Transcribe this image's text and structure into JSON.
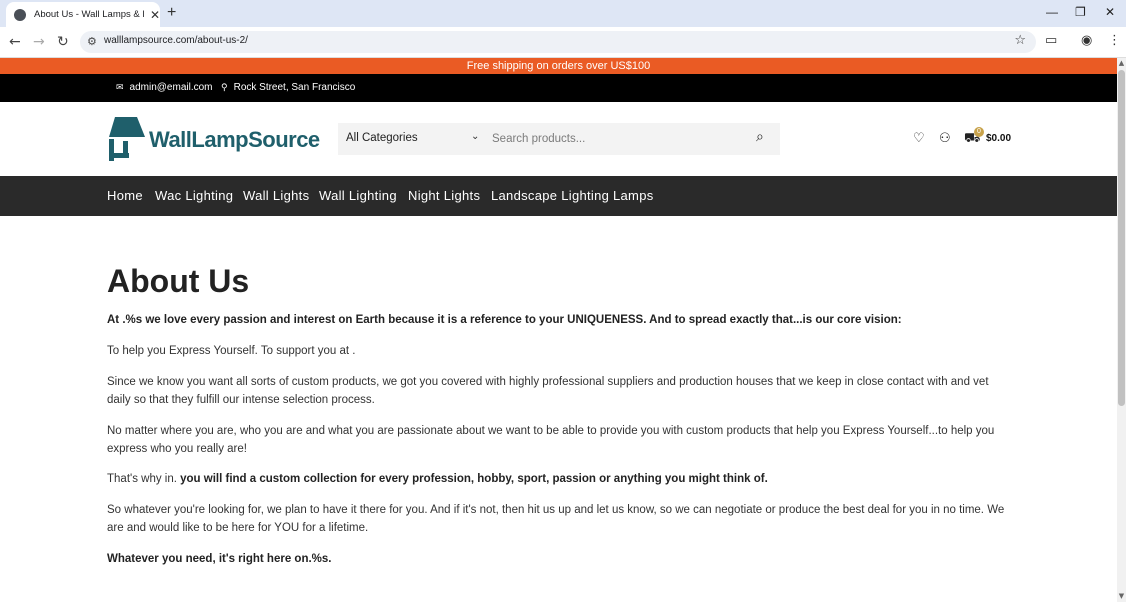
{
  "browser": {
    "tab_title": "About Us - Wall Lamps & Lighting",
    "url": "walllampsource.com/about-us-2/"
  },
  "promo": {
    "text": "Free shipping on orders over US$100"
  },
  "topbar": {
    "email": "admin@email.com",
    "address": "Rock Street, San Francisco"
  },
  "header": {
    "brand": "WallLampSource",
    "category_select": "All Categories",
    "search_placeholder": "Search products...",
    "cart_count": "0",
    "cart_total": "$0.00"
  },
  "nav": {
    "items": [
      "Home",
      "Wac Lighting",
      "Wall Lights",
      "Wall Lighting",
      "Night Lights",
      "Landscape Lighting",
      "Lamps"
    ]
  },
  "page": {
    "title": "About Us",
    "p1": "At .%s we love every passion and interest on Earth because it is a reference to your UNIQUENESS. And to spread exactly that...is our core vision:",
    "p2": "To help you Express Yourself. To support you at .",
    "p3": "Since we know you want all sorts of custom products, we got you covered with highly professional suppliers and production houses that we keep in close contact with and vet daily so that they fulfill our intense selection process.",
    "p4": "No matter where you are, who you are and what you are passionate about we want to be able to provide you with custom products that help you Express Yourself...to help you express who you really are!",
    "p5_plain": "That's why in. ",
    "p5_bold": "you will find a custom collection for every profession, hobby, sport, passion or anything you might think of.",
    "p6": "So whatever you're looking for, we plan to have it there for you. And if it's not, then hit us up and let us know, so we can negotiate or produce the best deal for you in no time. We are and would like to be here for YOU for a lifetime.",
    "p7": "Whatever you need, it's right here on.%s."
  },
  "colors": {
    "promo": "#ea5b24",
    "nav_bg": "#2a2a2a",
    "brand": "#1f5f6b"
  }
}
